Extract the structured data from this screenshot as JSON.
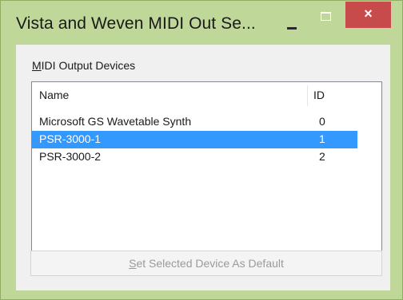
{
  "window": {
    "title": "Vista and Weven MIDI Out Se...",
    "minimize_glyph": "minimize-icon",
    "maximize_glyph": "maximize-icon",
    "close_glyph": "×"
  },
  "group": {
    "label_accel": "M",
    "label_rest": "IDI Output Devices"
  },
  "list": {
    "columns": [
      "Name",
      "ID"
    ],
    "rows": [
      {
        "name": "Microsoft GS Wavetable Synth",
        "id": "0",
        "selected": false
      },
      {
        "name": "PSR-3000-1",
        "id": "1",
        "selected": true
      },
      {
        "name": "PSR-3000-2",
        "id": "2",
        "selected": false
      }
    ]
  },
  "default_button": {
    "label_accel": "S",
    "label_rest": "et Selected Device As Default",
    "enabled": false
  },
  "colors": {
    "frame": "#bfd798",
    "close": "#c74b4b",
    "selection": "#3399ff"
  }
}
